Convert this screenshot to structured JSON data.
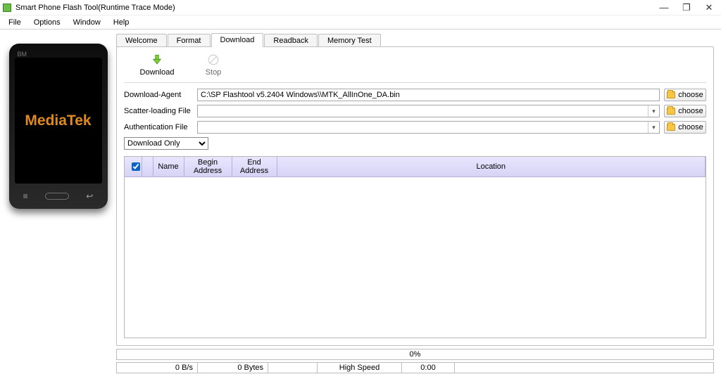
{
  "window": {
    "title": "Smart Phone Flash Tool(Runtime Trace Mode)"
  },
  "menu": {
    "file": "File",
    "options": "Options",
    "window": "Window",
    "help": "Help"
  },
  "phone": {
    "bm": "BM",
    "brand": "MediaTek"
  },
  "tabs": {
    "welcome": "Welcome",
    "format": "Format",
    "download": "Download",
    "readback": "Readback",
    "memory": "Memory Test"
  },
  "actions": {
    "download": "Download",
    "stop": "Stop"
  },
  "fields": {
    "download_agent_label": "Download-Agent",
    "download_agent_value": "C:\\SP Flashtool v5.2404 Windows\\\\MTK_AllInOne_DA.bin",
    "scatter_label": "Scatter-loading File",
    "scatter_value": "",
    "auth_label": "Authentication File",
    "auth_value": "",
    "choose_label": "choose",
    "mode_selected": "Download Only"
  },
  "grid": {
    "col_name": "Name",
    "col_begin": "Begin Address",
    "col_end": "End Address",
    "col_location": "Location"
  },
  "progress": {
    "percent": "0%"
  },
  "status": {
    "speed": "0 B/s",
    "bytes": "0 Bytes",
    "conn": "High Speed",
    "time": "0:00"
  }
}
